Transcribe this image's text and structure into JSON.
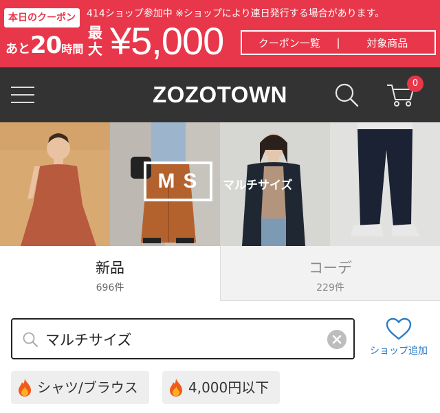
{
  "banner": {
    "badge": "本日のクーポン",
    "countdown_prefix": "あと",
    "countdown_number": "20",
    "countdown_suffix": "時間",
    "note": "414ショップ参加中 ※ショップにより連日発行する場合があります。",
    "max_label": "最大",
    "amount": "¥5,000",
    "link_coupons": "クーポン一覧",
    "separator": "|",
    "link_items": "対象商品",
    "color": "#e8374a"
  },
  "header": {
    "logo": "ZOZOTOWN",
    "cart_count": "0",
    "icons": [
      "menu-icon",
      "search-icon",
      "cart-icon"
    ],
    "background": "#333333"
  },
  "hero": {
    "logo_text": "MS",
    "label": "マルチサイズ"
  },
  "tabs": [
    {
      "title": "新品",
      "count": "696件",
      "active": true
    },
    {
      "title": "コーデ",
      "count": "229件",
      "active": false
    }
  ],
  "search": {
    "value": "マルチサイズ",
    "favorite_label": "ショップ追加"
  },
  "chips": [
    {
      "label": "シャツ/ブラウス",
      "icon": "flame-icon"
    },
    {
      "label": "4,000円以下",
      "icon": "flame-icon"
    }
  ]
}
